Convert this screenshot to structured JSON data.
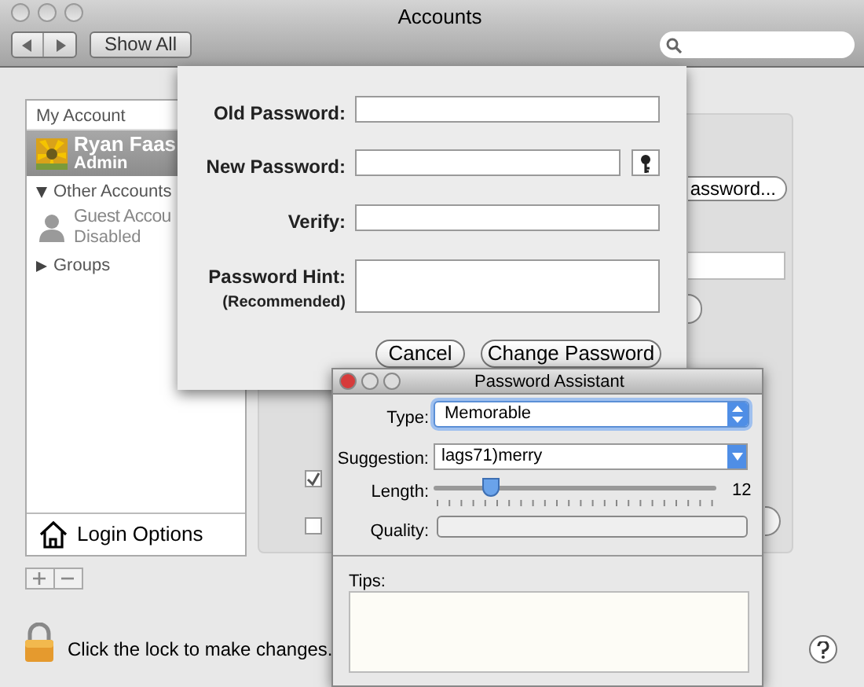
{
  "window": {
    "title": "Accounts",
    "show_all": "Show All"
  },
  "sidebar": {
    "sections": [
      {
        "label": "My Account",
        "items": [
          {
            "name": "Ryan Faas",
            "detail": "Admin",
            "selected": true,
            "kind": "picture"
          }
        ]
      },
      {
        "label": "Other Accounts",
        "expanded": true,
        "items": [
          {
            "name": "Guest Accou",
            "detail": "Disabled",
            "selected": false,
            "kind": "silhouette"
          }
        ]
      },
      {
        "label": "Groups",
        "expanded": false
      }
    ],
    "login_options": "Login Options"
  },
  "background_panel": {
    "button": "assword...",
    "checkboxes": [
      {
        "checked": true
      },
      {
        "checked": false
      }
    ]
  },
  "lock": {
    "text": "Click the lock to make changes."
  },
  "sheet": {
    "fields": [
      {
        "label": "Old Password:",
        "kind": "field"
      },
      {
        "label": "New Password:",
        "kind": "field-key"
      },
      {
        "label": "Verify:",
        "kind": "field"
      },
      {
        "label": "Password Hint:",
        "note": "(Recommended)",
        "kind": "area"
      }
    ],
    "buttons": [
      {
        "label": "Cancel"
      },
      {
        "label": "Change Password"
      }
    ]
  },
  "assistant": {
    "title": "Password Assistant",
    "type_label": "Type:",
    "type_value": "Memorable",
    "suggestion_label": "Suggestion:",
    "suggestion_value": "lags71)merry",
    "length_label": "Length:",
    "length": {
      "level": 0.2
    },
    "length_value": "12",
    "quality_label": "Quality:",
    "tips_label": "Tips:"
  }
}
